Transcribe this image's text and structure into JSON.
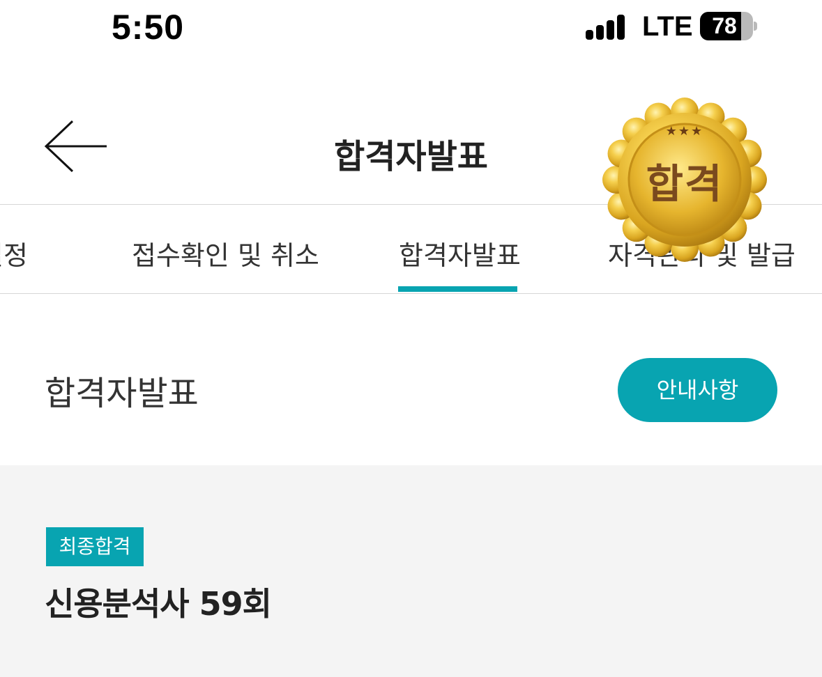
{
  "status_bar": {
    "time": "5:50",
    "network": "LTE",
    "battery_level": "78",
    "battery_fraction": 0.78
  },
  "header": {
    "title": "합격자발표",
    "back_icon": "arrow-left-icon"
  },
  "tabs": [
    {
      "label": "일정"
    },
    {
      "label": "접수확인 및 취소"
    },
    {
      "label": "합격자발표",
      "active": true
    },
    {
      "label": "자격관리 및 발급"
    }
  ],
  "accent_color": "#08a4b1",
  "section": {
    "title": "합격자발표",
    "notice_button": "안내사항"
  },
  "result_card": {
    "badge": "최종합격",
    "exam_name": "신용분석사 59회",
    "medal_text": "합격",
    "medal_stars": "★★★",
    "medal_icon": "gold-medal-icon"
  }
}
